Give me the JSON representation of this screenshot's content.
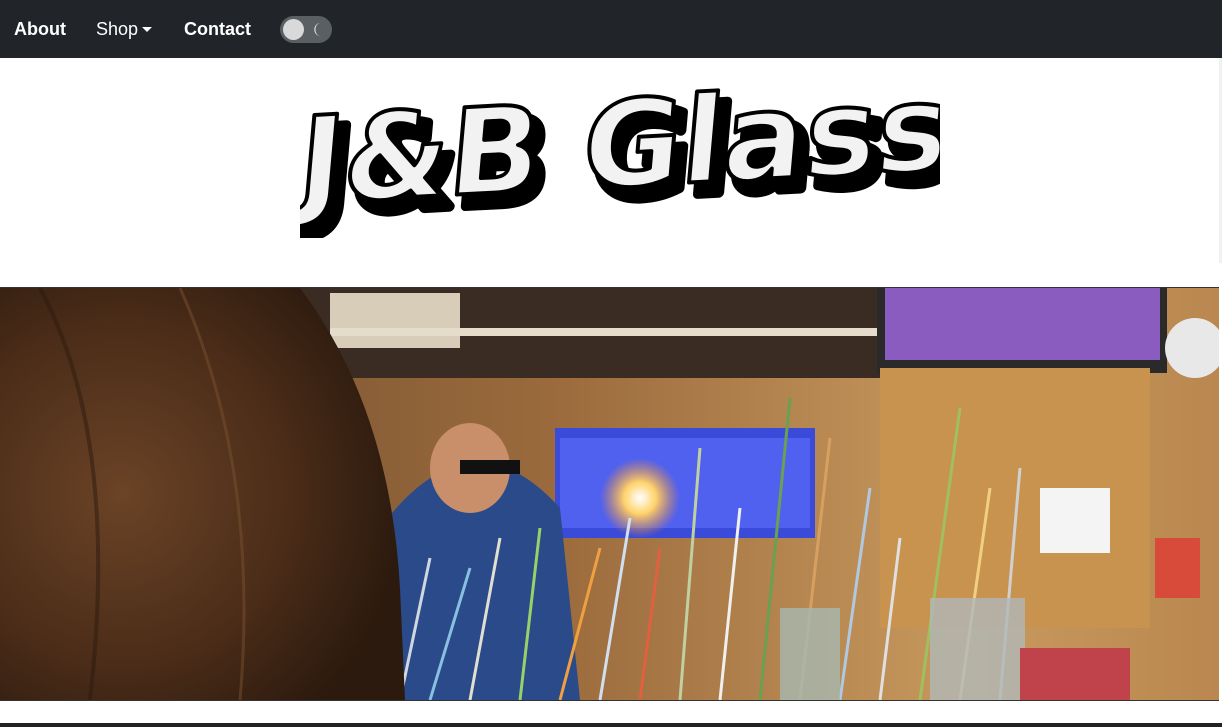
{
  "nav": {
    "about_label": "About",
    "shop_label": "Shop",
    "contact_label": "Contact",
    "theme_toggle": {
      "icon": "moon-icon",
      "state": "off"
    }
  },
  "logo": {
    "text": "J&B Glass"
  },
  "banner": {
    "alt": "Glassblower working at a torch in a workshop"
  },
  "colors": {
    "navbar": "#212529",
    "logo_fill": "#f2f2f2",
    "logo_shadow": "#000000"
  }
}
